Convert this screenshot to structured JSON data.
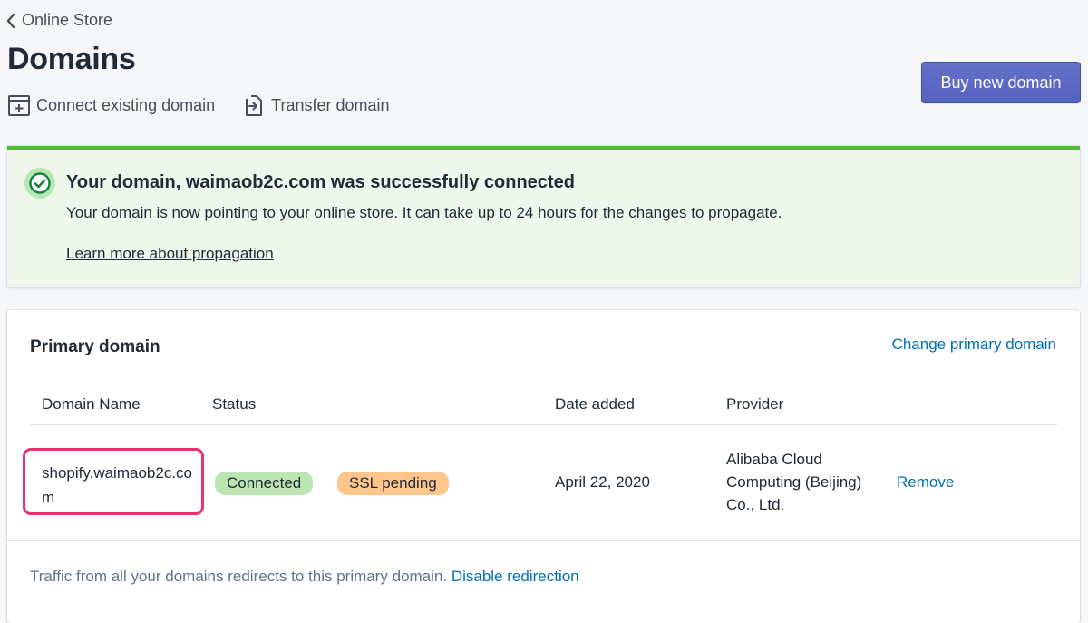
{
  "breadcrumb": {
    "label": "Online Store"
  },
  "page": {
    "title": "Domains"
  },
  "actions": {
    "connect_label": "Connect existing domain",
    "transfer_label": "Transfer domain",
    "buy_label": "Buy new domain"
  },
  "banner": {
    "title": "Your domain, waimaob2c.com was successfully connected",
    "text": "Your domain is now pointing to your online store. It can take up to 24 hours for the changes to propagate.",
    "link": "Learn more about propagation"
  },
  "primary_domain": {
    "title": "Primary domain",
    "change_link": "Change primary domain",
    "columns": [
      "Domain Name",
      "Status",
      "Date added",
      "Provider"
    ],
    "row": {
      "domain": "shopify.waimaob2c.com",
      "status_connected": "Connected",
      "status_ssl": "SSL pending",
      "date_added": "April 22, 2020",
      "provider": "Alibaba Cloud Computing (Beijing) Co., Ltd.",
      "remove_label": "Remove"
    },
    "footer_text": "Traffic from all your domains redirects to this primary domain.",
    "footer_link": "Disable redirection"
  },
  "colors": {
    "primary_button": "#5c6ac4",
    "success_border": "#50b83c",
    "success_bg": "#eef7ea",
    "badge_success": "#bbe5b3",
    "badge_warning": "#ffc58b",
    "link": "#006fbb",
    "highlight": "#e8336e"
  },
  "icons": {
    "back": "chevron-left-icon",
    "connect": "connect-domain-icon",
    "transfer": "transfer-domain-icon",
    "success": "check-circle-icon"
  }
}
